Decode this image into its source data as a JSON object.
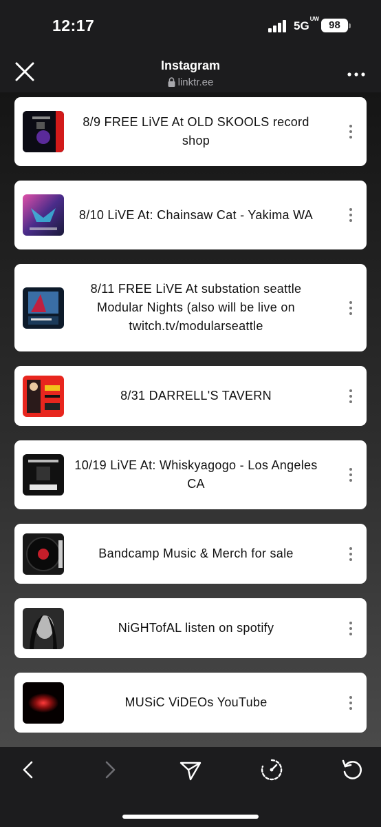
{
  "status": {
    "time": "12:17",
    "network": "5G",
    "network_sup": "UW",
    "battery": "98"
  },
  "header": {
    "title": "Instagram",
    "url": "linktr.ee"
  },
  "links": [
    {
      "label": "8/9 FREE LiVE At OLD SKOOLS record shop"
    },
    {
      "label": "8/10 LiVE At: Chainsaw Cat - Yakima WA"
    },
    {
      "label": "8/11 FREE LiVE At substation seattle Modular Nights (also will be live on twitch.tv/modularseattle"
    },
    {
      "label": "8/31 DARRELL'S TAVERN"
    },
    {
      "label": "10/19 LiVE At: Whiskyagogo - Los Angeles CA"
    },
    {
      "label": "Bandcamp Music & Merch for sale"
    },
    {
      "label": "NiGHTofAL listen on spotify"
    },
    {
      "label": "MUSiC ViDEOs YouTube"
    }
  ],
  "colors": {
    "background": "#1c1c1e",
    "card": "#ffffff",
    "text": "#111111"
  },
  "toolbar": {
    "icons": [
      "back-icon",
      "forward-icon",
      "share-icon",
      "speedometer-icon",
      "reload-icon"
    ]
  }
}
